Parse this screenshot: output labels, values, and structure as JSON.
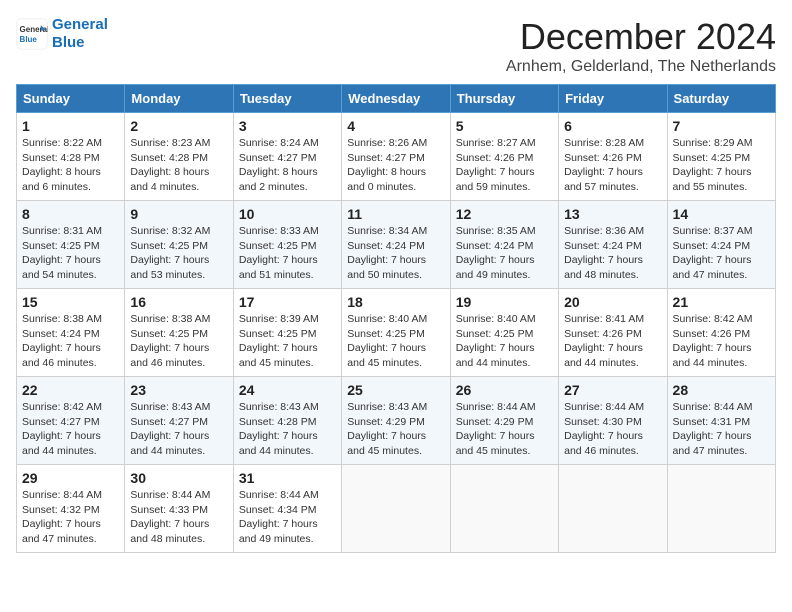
{
  "logo": {
    "line1": "General",
    "line2": "Blue"
  },
  "title": "December 2024",
  "subtitle": "Arnhem, Gelderland, The Netherlands",
  "days_of_week": [
    "Sunday",
    "Monday",
    "Tuesday",
    "Wednesday",
    "Thursday",
    "Friday",
    "Saturday"
  ],
  "weeks": [
    [
      {
        "day": "1",
        "sunrise": "Sunrise: 8:22 AM",
        "sunset": "Sunset: 4:28 PM",
        "daylight": "Daylight: 8 hours and 6 minutes."
      },
      {
        "day": "2",
        "sunrise": "Sunrise: 8:23 AM",
        "sunset": "Sunset: 4:28 PM",
        "daylight": "Daylight: 8 hours and 4 minutes."
      },
      {
        "day": "3",
        "sunrise": "Sunrise: 8:24 AM",
        "sunset": "Sunset: 4:27 PM",
        "daylight": "Daylight: 8 hours and 2 minutes."
      },
      {
        "day": "4",
        "sunrise": "Sunrise: 8:26 AM",
        "sunset": "Sunset: 4:27 PM",
        "daylight": "Daylight: 8 hours and 0 minutes."
      },
      {
        "day": "5",
        "sunrise": "Sunrise: 8:27 AM",
        "sunset": "Sunset: 4:26 PM",
        "daylight": "Daylight: 7 hours and 59 minutes."
      },
      {
        "day": "6",
        "sunrise": "Sunrise: 8:28 AM",
        "sunset": "Sunset: 4:26 PM",
        "daylight": "Daylight: 7 hours and 57 minutes."
      },
      {
        "day": "7",
        "sunrise": "Sunrise: 8:29 AM",
        "sunset": "Sunset: 4:25 PM",
        "daylight": "Daylight: 7 hours and 55 minutes."
      }
    ],
    [
      {
        "day": "8",
        "sunrise": "Sunrise: 8:31 AM",
        "sunset": "Sunset: 4:25 PM",
        "daylight": "Daylight: 7 hours and 54 minutes."
      },
      {
        "day": "9",
        "sunrise": "Sunrise: 8:32 AM",
        "sunset": "Sunset: 4:25 PM",
        "daylight": "Daylight: 7 hours and 53 minutes."
      },
      {
        "day": "10",
        "sunrise": "Sunrise: 8:33 AM",
        "sunset": "Sunset: 4:25 PM",
        "daylight": "Daylight: 7 hours and 51 minutes."
      },
      {
        "day": "11",
        "sunrise": "Sunrise: 8:34 AM",
        "sunset": "Sunset: 4:24 PM",
        "daylight": "Daylight: 7 hours and 50 minutes."
      },
      {
        "day": "12",
        "sunrise": "Sunrise: 8:35 AM",
        "sunset": "Sunset: 4:24 PM",
        "daylight": "Daylight: 7 hours and 49 minutes."
      },
      {
        "day": "13",
        "sunrise": "Sunrise: 8:36 AM",
        "sunset": "Sunset: 4:24 PM",
        "daylight": "Daylight: 7 hours and 48 minutes."
      },
      {
        "day": "14",
        "sunrise": "Sunrise: 8:37 AM",
        "sunset": "Sunset: 4:24 PM",
        "daylight": "Daylight: 7 hours and 47 minutes."
      }
    ],
    [
      {
        "day": "15",
        "sunrise": "Sunrise: 8:38 AM",
        "sunset": "Sunset: 4:24 PM",
        "daylight": "Daylight: 7 hours and 46 minutes."
      },
      {
        "day": "16",
        "sunrise": "Sunrise: 8:38 AM",
        "sunset": "Sunset: 4:25 PM",
        "daylight": "Daylight: 7 hours and 46 minutes."
      },
      {
        "day": "17",
        "sunrise": "Sunrise: 8:39 AM",
        "sunset": "Sunset: 4:25 PM",
        "daylight": "Daylight: 7 hours and 45 minutes."
      },
      {
        "day": "18",
        "sunrise": "Sunrise: 8:40 AM",
        "sunset": "Sunset: 4:25 PM",
        "daylight": "Daylight: 7 hours and 45 minutes."
      },
      {
        "day": "19",
        "sunrise": "Sunrise: 8:40 AM",
        "sunset": "Sunset: 4:25 PM",
        "daylight": "Daylight: 7 hours and 44 minutes."
      },
      {
        "day": "20",
        "sunrise": "Sunrise: 8:41 AM",
        "sunset": "Sunset: 4:26 PM",
        "daylight": "Daylight: 7 hours and 44 minutes."
      },
      {
        "day": "21",
        "sunrise": "Sunrise: 8:42 AM",
        "sunset": "Sunset: 4:26 PM",
        "daylight": "Daylight: 7 hours and 44 minutes."
      }
    ],
    [
      {
        "day": "22",
        "sunrise": "Sunrise: 8:42 AM",
        "sunset": "Sunset: 4:27 PM",
        "daylight": "Daylight: 7 hours and 44 minutes."
      },
      {
        "day": "23",
        "sunrise": "Sunrise: 8:43 AM",
        "sunset": "Sunset: 4:27 PM",
        "daylight": "Daylight: 7 hours and 44 minutes."
      },
      {
        "day": "24",
        "sunrise": "Sunrise: 8:43 AM",
        "sunset": "Sunset: 4:28 PM",
        "daylight": "Daylight: 7 hours and 44 minutes."
      },
      {
        "day": "25",
        "sunrise": "Sunrise: 8:43 AM",
        "sunset": "Sunset: 4:29 PM",
        "daylight": "Daylight: 7 hours and 45 minutes."
      },
      {
        "day": "26",
        "sunrise": "Sunrise: 8:44 AM",
        "sunset": "Sunset: 4:29 PM",
        "daylight": "Daylight: 7 hours and 45 minutes."
      },
      {
        "day": "27",
        "sunrise": "Sunrise: 8:44 AM",
        "sunset": "Sunset: 4:30 PM",
        "daylight": "Daylight: 7 hours and 46 minutes."
      },
      {
        "day": "28",
        "sunrise": "Sunrise: 8:44 AM",
        "sunset": "Sunset: 4:31 PM",
        "daylight": "Daylight: 7 hours and 47 minutes."
      }
    ],
    [
      {
        "day": "29",
        "sunrise": "Sunrise: 8:44 AM",
        "sunset": "Sunset: 4:32 PM",
        "daylight": "Daylight: 7 hours and 47 minutes."
      },
      {
        "day": "30",
        "sunrise": "Sunrise: 8:44 AM",
        "sunset": "Sunset: 4:33 PM",
        "daylight": "Daylight: 7 hours and 48 minutes."
      },
      {
        "day": "31",
        "sunrise": "Sunrise: 8:44 AM",
        "sunset": "Sunset: 4:34 PM",
        "daylight": "Daylight: 7 hours and 49 minutes."
      },
      null,
      null,
      null,
      null
    ]
  ]
}
